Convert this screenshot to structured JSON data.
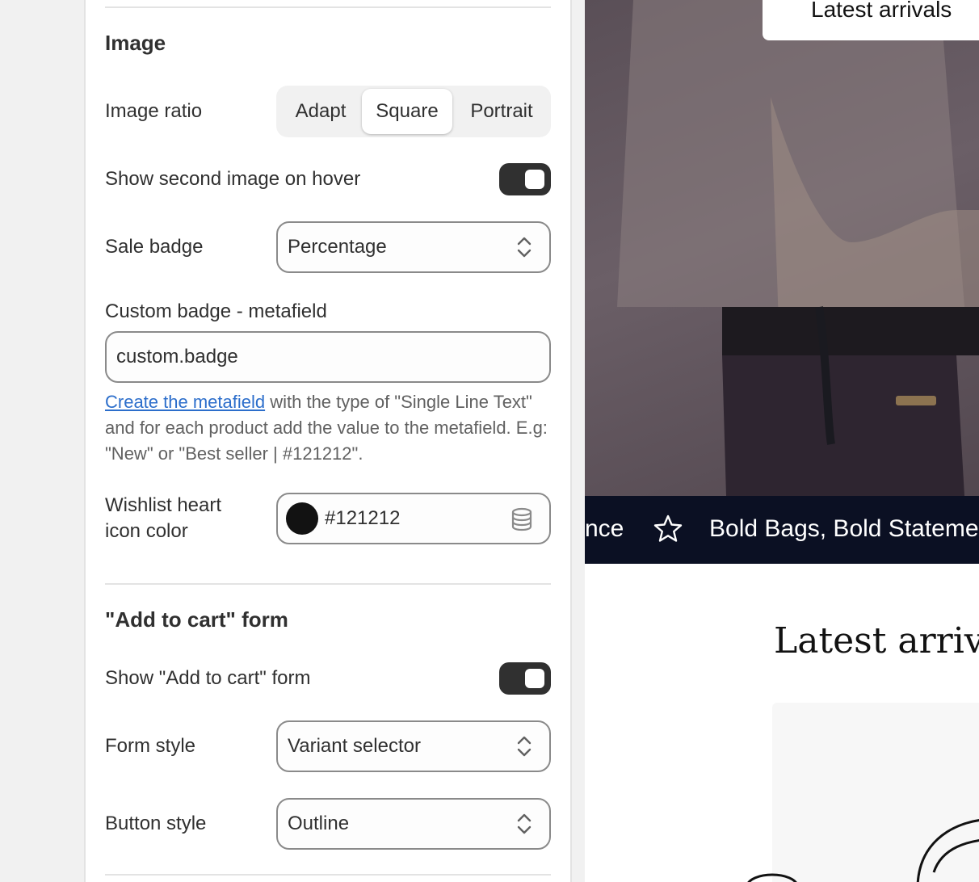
{
  "image_section": {
    "title": "Image",
    "ratio_label": "Image ratio",
    "ratio_options": [
      "Adapt",
      "Square",
      "Portrait"
    ],
    "ratio_selected": "Square",
    "hover_label": "Show second image on hover",
    "hover_enabled": true,
    "sale_badge_label": "Sale badge",
    "sale_badge_value": "Percentage",
    "custom_badge_label": "Custom badge - metafield",
    "custom_badge_value": "custom.badge",
    "help_link": "Create the metafield",
    "help_text": " with the type of \"Single Line Text\" and for each product add the value to the metafield. E.g: \"New\" or \"Best seller | #121212\".",
    "wishlist_label": "Wishlist heart icon color",
    "wishlist_color": "#121212",
    "wishlist_color_text": "#121212"
  },
  "cart_section": {
    "title": "\"Add to cart\" form",
    "show_label": "Show \"Add to cart\" form",
    "show_enabled": true,
    "form_style_label": "Form style",
    "form_style_value": "Variant selector",
    "button_style_label": "Button style",
    "button_style_value": "Outline"
  },
  "preview": {
    "hero_chip": "Latest arrivals",
    "marquee_left": "nce",
    "marquee_right": "Bold Bags, Bold Statements",
    "heading": "Latest arrivals"
  },
  "colors": {
    "accent": "#303030",
    "link": "#2c6ecb",
    "marquee_bg": "#0b1023"
  },
  "icons": [
    "chevron-updown-icon",
    "database-icon",
    "star-icon"
  ]
}
